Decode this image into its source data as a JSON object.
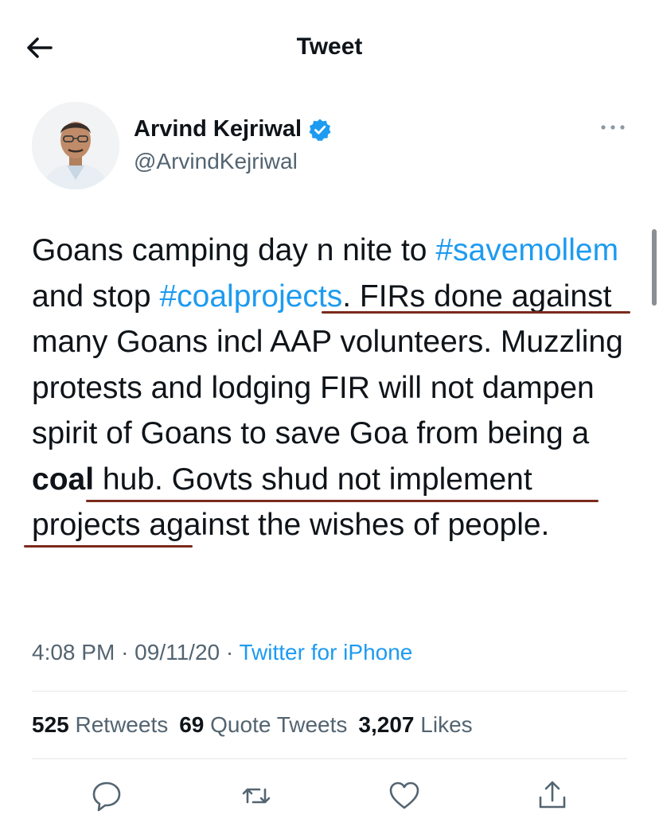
{
  "header": {
    "title": "Tweet",
    "back_icon": "arrow-left-icon"
  },
  "author": {
    "name": "Arvind Kejriwal",
    "handle": "@ArvindKejriwal",
    "verified_icon": "verified-badge-icon",
    "more_icon": "more-options-icon"
  },
  "tweet": {
    "segments": [
      "Goans camping day n nite to ",
      "#savemollem",
      " and stop ",
      "#coalprojects",
      ". FIRs done against many Goans incl AAP volunteers. Muzzling protests and lodging FIR will not dampen spirit of Goans to save Goa from being a ",
      "coal",
      " hub. Govts shud not implement projects against the wishes of people."
    ]
  },
  "meta": {
    "time": "4:08 PM",
    "separator": "·",
    "date": "09/11/20",
    "source": "Twitter for iPhone"
  },
  "stats": {
    "retweets_count": "525",
    "retweets_label": "Retweets",
    "quotes_count": "69",
    "quotes_label": "Quote Tweets",
    "likes_count": "3,207",
    "likes_label": "Likes"
  },
  "actions": [
    "reply-icon",
    "retweet-icon",
    "like-icon",
    "share-icon"
  ],
  "colors": {
    "link": "#1d9bf0",
    "text": "#0f1419",
    "secondary": "#536471",
    "underline_marks": "#7a2a1c"
  }
}
